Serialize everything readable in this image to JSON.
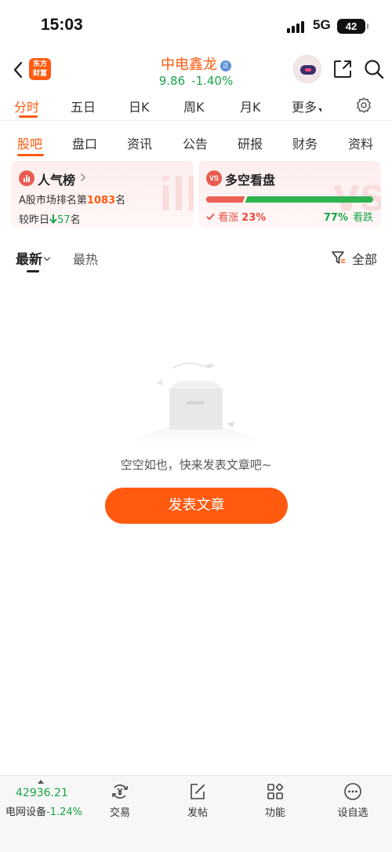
{
  "status_bar": {
    "time": "15:03",
    "network": "5G",
    "battery": "42"
  },
  "header": {
    "logo_text_line1": "东方",
    "logo_text_line2": "财富",
    "stock_name": "中电鑫龙",
    "stock_tag": "正",
    "price": "9.86",
    "change_pct": "-1.40%"
  },
  "period_tabs": [
    {
      "label": "分时",
      "active": true
    },
    {
      "label": "五日"
    },
    {
      "label": "日K"
    },
    {
      "label": "周K"
    },
    {
      "label": "月K"
    },
    {
      "label": "更多"
    }
  ],
  "info_tabs": [
    {
      "label": "股吧",
      "active": true
    },
    {
      "label": "盘口"
    },
    {
      "label": "资讯"
    },
    {
      "label": "公告"
    },
    {
      "label": "研报"
    },
    {
      "label": "财务"
    },
    {
      "label": "资料"
    }
  ],
  "popularity_card": {
    "title": "人气榜",
    "rank_prefix": "A股市场排名第",
    "rank_value": "1083",
    "rank_suffix": "名",
    "change_prefix": "较昨日",
    "change_value": "57",
    "change_suffix": "名"
  },
  "sentiment_card": {
    "icon_text": "VS",
    "title": "多空看盘",
    "bull_label": "看涨",
    "bull_pct": "23%",
    "bear_label": "看跌",
    "bear_pct": "77%",
    "bull_fraction": 0.23
  },
  "sort_row": {
    "latest": "最新",
    "hot": "最热",
    "filter_all": "全部"
  },
  "empty_state": {
    "message": "空空如也，快来发表文章吧~",
    "button_label": "发表文章"
  },
  "bottom_bar": {
    "index_value": "42936.21",
    "index_name": "电网设备",
    "index_change": "-1.24%",
    "items": [
      {
        "label": "交易",
        "icon": "trade-icon"
      },
      {
        "label": "发帖",
        "icon": "post-icon"
      },
      {
        "label": "功能",
        "icon": "apps-icon"
      },
      {
        "label": "设自选",
        "icon": "more-icon"
      }
    ]
  },
  "colors": {
    "accent": "#ff5a10",
    "up": "#ee4b3e",
    "down": "#1aa34a"
  }
}
